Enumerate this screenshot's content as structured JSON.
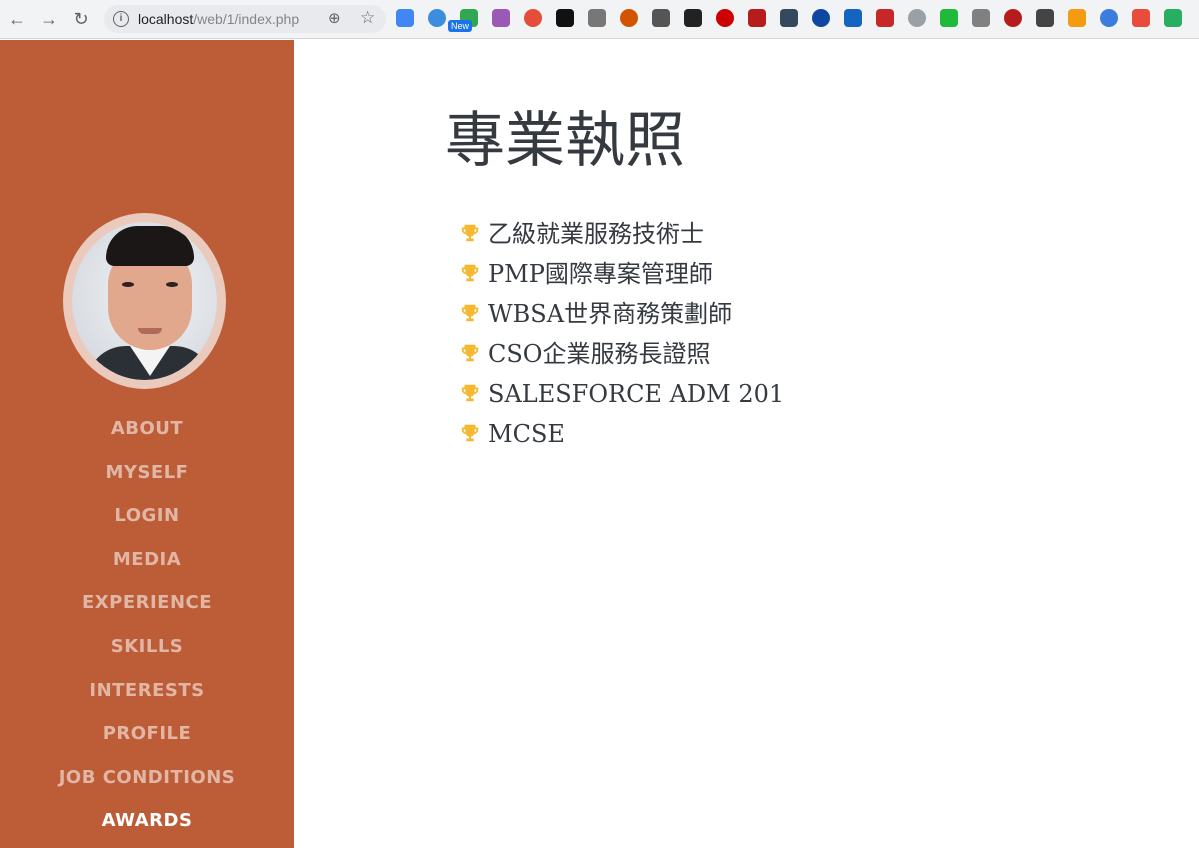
{
  "browser": {
    "url_host": "localhost",
    "url_path": "/web/1/index.php",
    "extensions_new_badge": "New",
    "extension_colors": [
      "#4285f4",
      "#3c8dde",
      "#2fa84f",
      "#9b59b6",
      "#e44d3a",
      "#111111",
      "#777777",
      "#d35400",
      "#555555",
      "#222222",
      "#cc0000",
      "#b71c1c",
      "#34495e",
      "#0d47a1",
      "#1565c0",
      "#c62828",
      "#9aa0a6",
      "#1fba3a",
      "#808080",
      "#b71c1c",
      "#444444",
      "#f39c12",
      "#3b7ddd",
      "#e74c3c",
      "#27ae60"
    ]
  },
  "sidebar": {
    "bg_color": "#bd5d38",
    "avatar_alt": "profile photo",
    "nav": [
      {
        "label": "ABOUT"
      },
      {
        "label": "MYSELF"
      },
      {
        "label": "LOGIN"
      },
      {
        "label": "MEDIA"
      },
      {
        "label": "EXPERIENCE"
      },
      {
        "label": "SKILLS"
      },
      {
        "label": "INTERESTS"
      },
      {
        "label": "PROFILE"
      },
      {
        "label": "JOB CONDITIONS"
      },
      {
        "label": "AWARDS"
      }
    ],
    "active_item": "AWARDS"
  },
  "main": {
    "title": "專業執照",
    "trophy_color": "#f5b82e",
    "awards": [
      "乙級就業服務技術士",
      "PMP國際專案管理師",
      "WBSA世界商務策劃師",
      "CSO企業服務長證照",
      "SALESFORCE ADM 201",
      "MCSE"
    ]
  }
}
